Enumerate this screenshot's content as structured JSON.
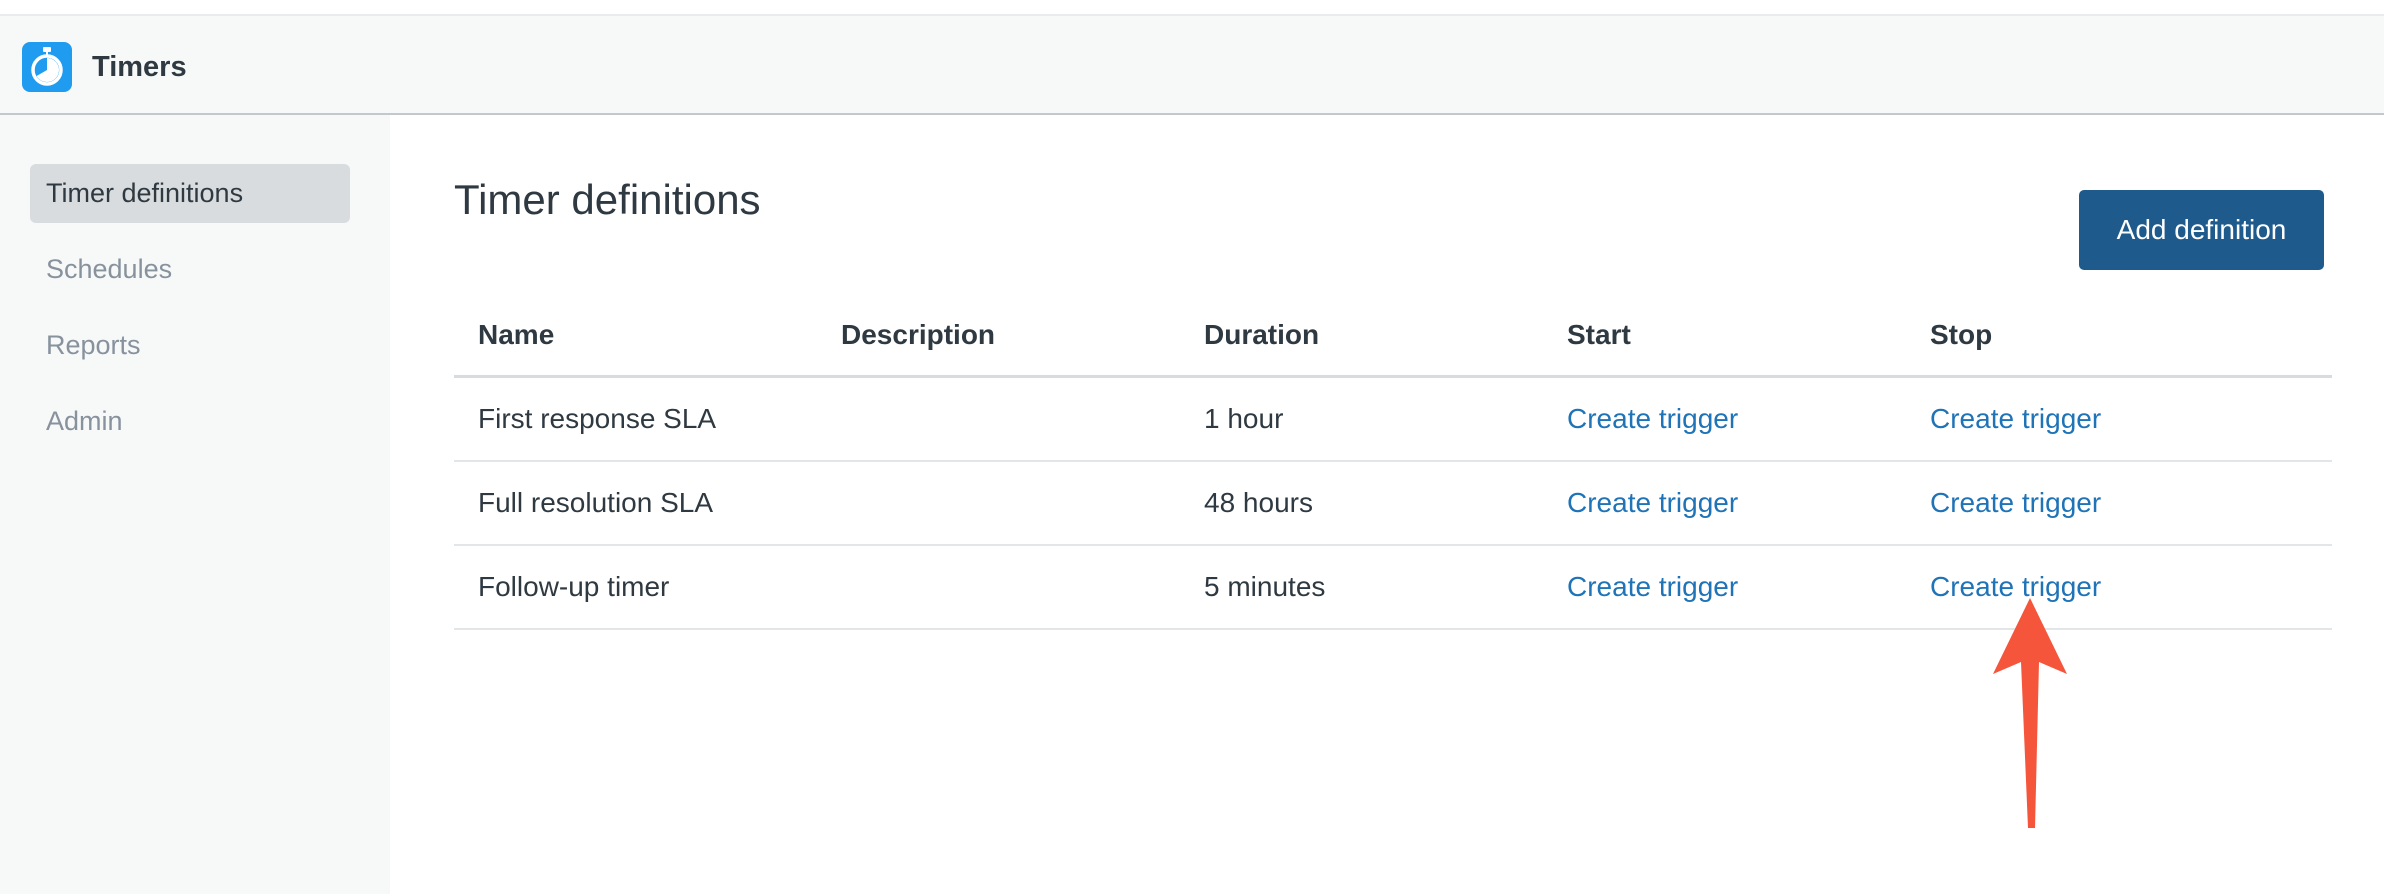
{
  "app": {
    "title": "Timers",
    "icon": "stopwatch-icon",
    "accent_color": "#1f9bf0"
  },
  "sidebar": {
    "items": [
      {
        "label": "Timer definitions",
        "active": true
      },
      {
        "label": "Schedules",
        "active": false
      },
      {
        "label": "Reports",
        "active": false
      },
      {
        "label": "Admin",
        "active": false
      }
    ]
  },
  "main": {
    "title": "Timer definitions",
    "add_button_label": "Add definition",
    "primary_color": "#1f5a8d",
    "link_color": "#1f73b7"
  },
  "table": {
    "headers": [
      "Name",
      "Description",
      "Duration",
      "Start",
      "Stop"
    ],
    "rows": [
      {
        "name": "First response SLA",
        "description": "",
        "duration": "1 hour",
        "start": "Create trigger",
        "stop": "Create trigger"
      },
      {
        "name": "Full resolution SLA",
        "description": "",
        "duration": "48 hours",
        "start": "Create trigger",
        "stop": "Create trigger"
      },
      {
        "name": "Follow-up timer",
        "description": "",
        "duration": "5 minutes",
        "start": "Create trigger",
        "stop": "Create trigger"
      }
    ]
  },
  "annotation": {
    "icon": "arrow-up-icon",
    "color": "#f4553b"
  }
}
